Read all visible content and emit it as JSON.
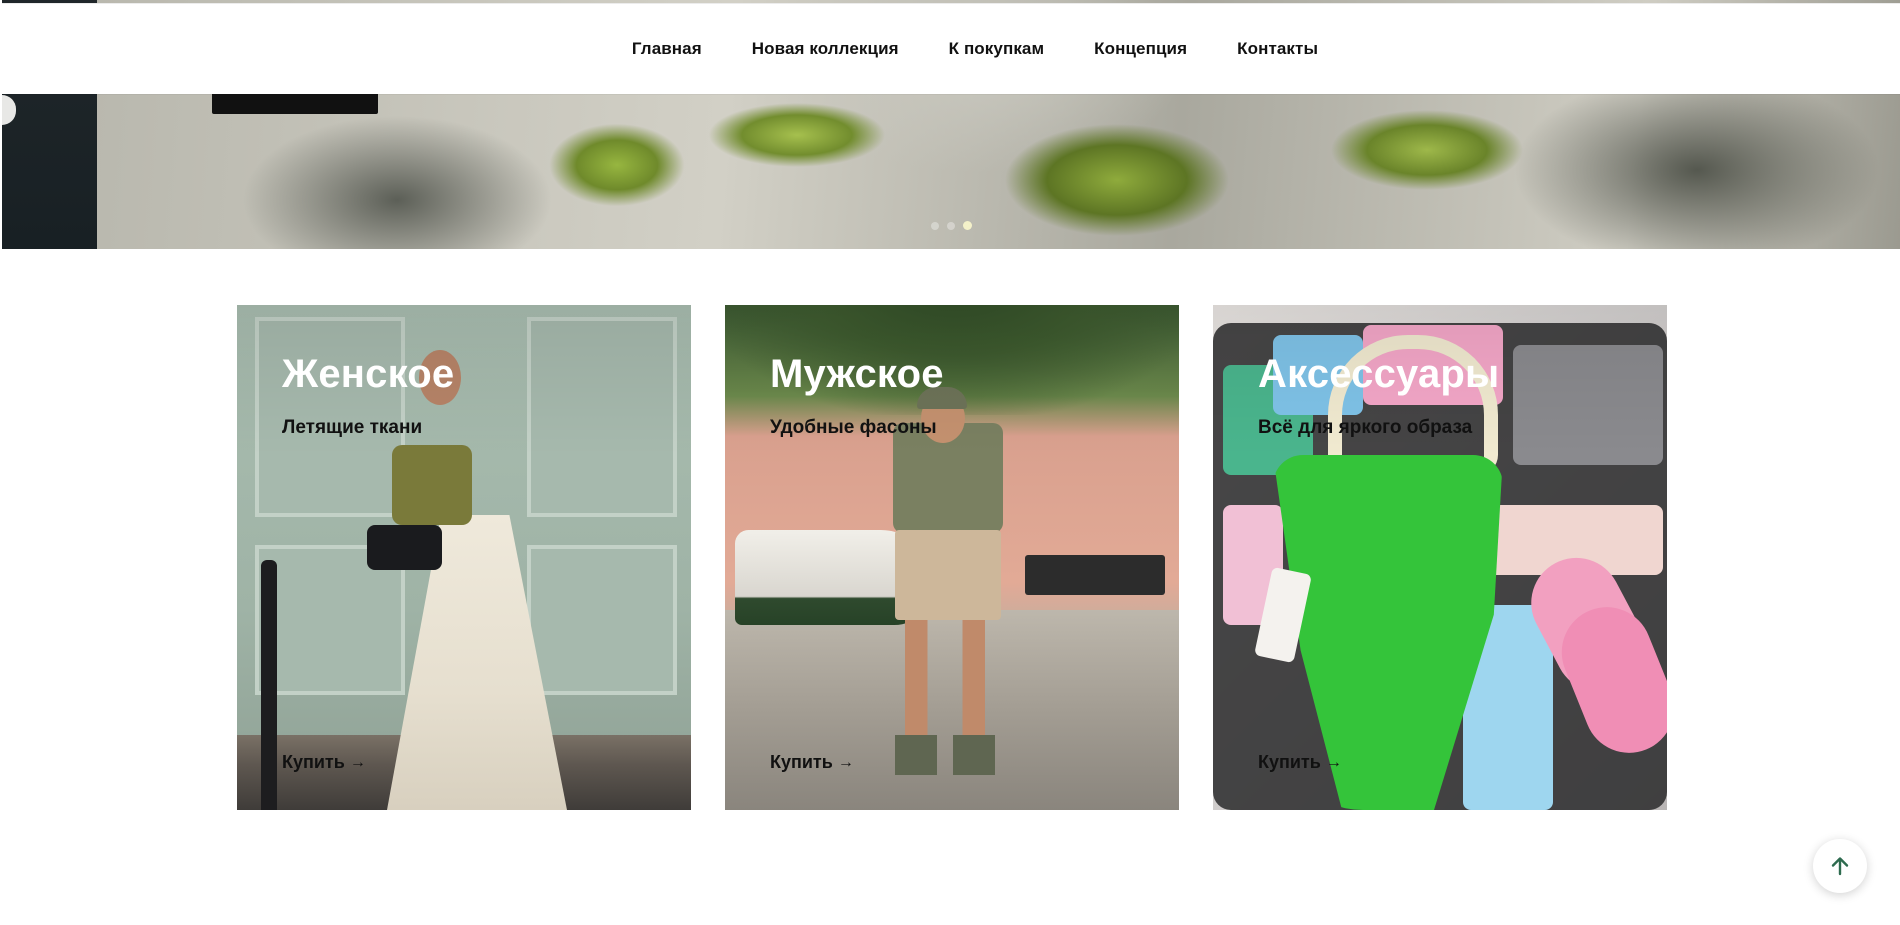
{
  "nav": {
    "items": [
      {
        "label": "Главная"
      },
      {
        "label": "Новая коллекция"
      },
      {
        "label": "К покупкам"
      },
      {
        "label": "Концепция"
      },
      {
        "label": "Контакты"
      }
    ]
  },
  "hero": {
    "slide_count": 3,
    "active_slide": 3
  },
  "categories": [
    {
      "title": "Женское",
      "subtitle": "Летящие ткани",
      "buy_label": "Купить",
      "buy_icon": "arrow-right-icon"
    },
    {
      "title": "Мужское",
      "subtitle": "Удобные фасоны",
      "buy_label": "Купить",
      "buy_icon": "arrow-right-icon"
    },
    {
      "title": "Аксессуары",
      "subtitle": "Всё для яркого образа",
      "buy_label": "Купить",
      "buy_icon": "arrow-right-icon"
    }
  ],
  "scroll_top": {
    "icon": "arrow-up-icon"
  },
  "colors": {
    "accent_green": "#2e6b4f",
    "text": "#111111",
    "dot_active": "#f4f1c9"
  }
}
